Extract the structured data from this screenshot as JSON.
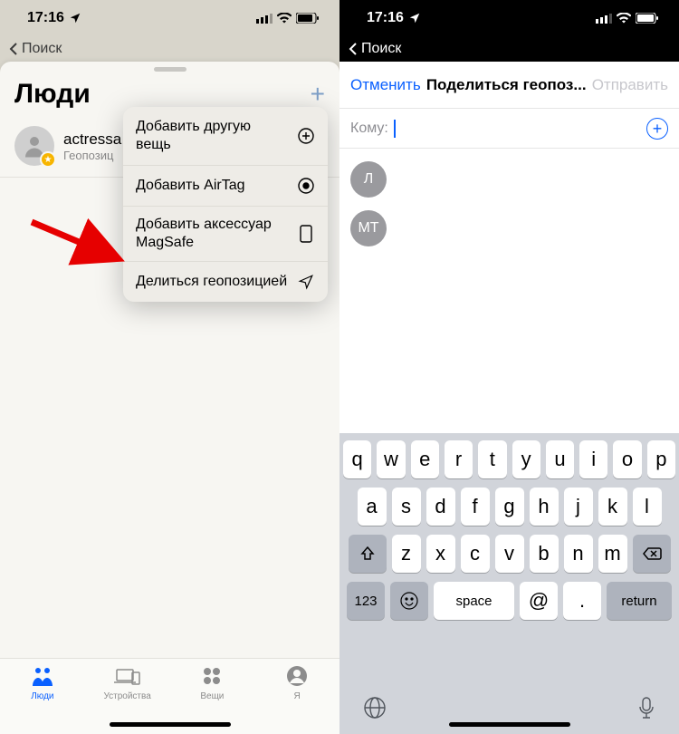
{
  "left": {
    "status": {
      "time": "17:16",
      "search_back": "Поиск"
    },
    "sheet": {
      "title": "Люди",
      "person": {
        "name": "actressa",
        "sub": "Геопозиц"
      }
    },
    "popover": {
      "items": [
        {
          "label": "Добавить другую вещь"
        },
        {
          "label": "Добавить AirTag"
        },
        {
          "label": "Добавить аксессуар MagSafe"
        },
        {
          "label": "Делиться геопозицией"
        }
      ]
    },
    "tabbar": {
      "people": "Люди",
      "devices": "Устройства",
      "items": "Вещи",
      "me": "Я"
    }
  },
  "right": {
    "status": {
      "time": "17:16",
      "search_back": "Поиск"
    },
    "modal": {
      "cancel": "Отменить",
      "title": "Поделиться геопоз...",
      "send": "Отправить",
      "to_label": "Кому:"
    },
    "contacts": [
      "Л",
      "МТ"
    ],
    "keyboard": {
      "row1": [
        "q",
        "w",
        "e",
        "r",
        "t",
        "y",
        "u",
        "i",
        "o",
        "p"
      ],
      "row2": [
        "a",
        "s",
        "d",
        "f",
        "g",
        "h",
        "j",
        "k",
        "l"
      ],
      "row3": [
        "z",
        "x",
        "c",
        "v",
        "b",
        "n",
        "m"
      ],
      "numkey": "123",
      "space": "space",
      "at": "@",
      "dot": ".",
      "return": "return"
    }
  }
}
